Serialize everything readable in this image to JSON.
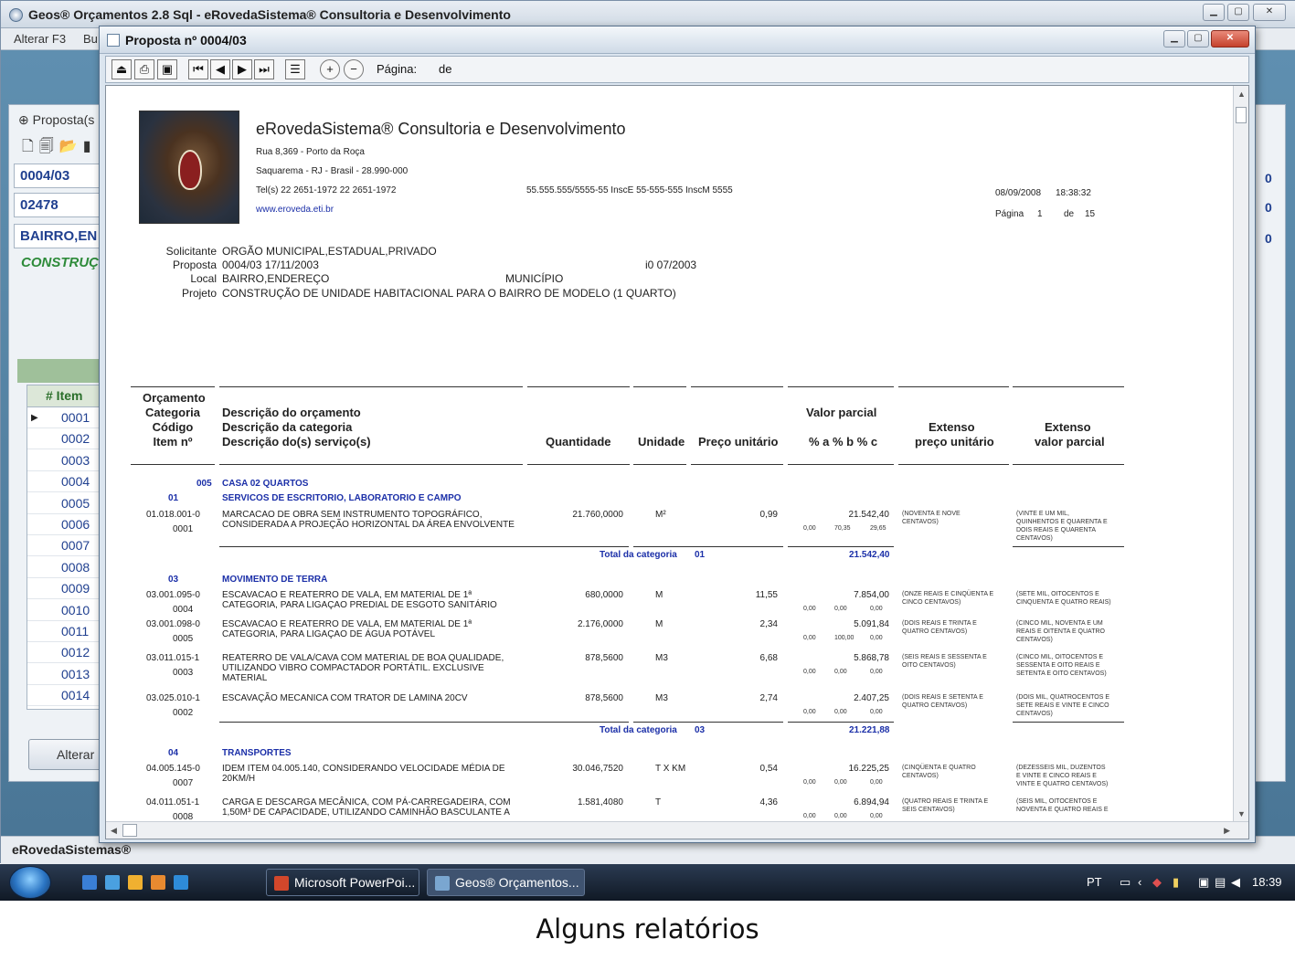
{
  "app": {
    "title": "Geos® Orçamentos 2.8 Sql - eRovedaSistema® Consultoria e Desenvolvimento",
    "menu": [
      "Alterar F3",
      "Bu"
    ],
    "status": "eRovedaSistemas®"
  },
  "left_panel": {
    "title": "Proposta(s",
    "fields": [
      "0004/03",
      "02478",
      "BAIRRO,EN"
    ],
    "construction": "CONSTRUÇ",
    "grid_header": "# Item",
    "rows": [
      "0001",
      "0002",
      "0003",
      "0004",
      "0005",
      "0006",
      "0007",
      "0008",
      "0009",
      "0010",
      "0011",
      "0012",
      "0013",
      "0014"
    ],
    "alterar": "Alterar"
  },
  "right_panel": {
    "values": [
      "0",
      "0",
      "0"
    ]
  },
  "dialog": {
    "title": "Proposta nº 0004/03",
    "page_label": "Página:",
    "of_label": "de"
  },
  "report": {
    "company": "eRovedaSistema® Consultoria e Desenvolvimento",
    "address": "Rua 8,369 - Porto da Roça",
    "city": "Saquarema - RJ - Brasil - 28.990-000",
    "phone": "Tel(s) 22 2651-1972 22 2651-1972",
    "docs": "55.555.555/5555-55 InscE 55-555-555 InscM 5555",
    "website": "www.eroveda.eti.br",
    "date": "08/09/2008",
    "time": "18:38:32",
    "page_label": "Página",
    "page_num": "1",
    "of_label": "de",
    "page_total": "15",
    "info": {
      "solicitante_label": "Solicitante",
      "solicitante": "ORGÃO MUNICIPAL,ESTADUAL,PRIVADO",
      "proposta_label": "Proposta",
      "proposta": "0004/03   17/11/2003",
      "proposta_extra": "i0   07/2003",
      "local_label": "Local",
      "local": "BAIRRO,ENDEREÇO",
      "municipio": "MUNICÍPIO",
      "projeto_label": "Projeto",
      "projeto": "CONSTRUÇÃO DE UNIDADE HABITACIONAL PARA O BAIRRO DE MODELO (1 QUARTO)"
    },
    "headers": {
      "col1": [
        "Orçamento",
        "Categoria",
        "Código",
        "Item nº"
      ],
      "col2": [
        "Descrição do orçamento",
        "Descrição da categoria",
        "Descrição do(s) serviço(s)"
      ],
      "quantidade": "Quantidade",
      "unidade": "Unidade",
      "preco": "Preço unitário",
      "valor_parcial": "Valor parcial",
      "percent": "% a % b % c",
      "extenso1": [
        "Extenso",
        "preço unitário"
      ],
      "extenso2": [
        "Extenso",
        "valor parcial"
      ]
    },
    "orcamento_code": "005",
    "orcamento_desc": "CASA 02 QUARTOS",
    "total_label": "Total da categoria",
    "categories": [
      {
        "code": "01",
        "name": "SERVICOS DE ESCRITORIO, LABORATORIO E CAMPO",
        "items": [
          {
            "code": "01.018.001-0",
            "num": "0001",
            "desc": [
              "MARCACAO  DE  OBRA  SEM  INSTRUMENTO  TOPOGRÁFICO,",
              "CONSIDERADA A PROJEÇÃO HORIZONTAL DA ÁREA ENVOLVENTE"
            ],
            "qty": "21.760,0000",
            "unit": "M²",
            "price": "0,99",
            "value": "21.542,40",
            "pct": [
              "0,00",
              "70,35",
              "29,65"
            ],
            "ext1": [
              "(NOVENTA E NOVE",
              "CENTAVOS)"
            ],
            "ext2": [
              "(VINTE E UM MIL,",
              "QUINHENTOS E QUARENTA E",
              "DOIS REAIS E QUARENTA",
              "CENTAVOS)"
            ]
          }
        ],
        "total_code": "01",
        "total": "21.542,40"
      },
      {
        "code": "03",
        "name": "MOVIMENTO DE TERRA",
        "items": [
          {
            "code": "03.001.095-0",
            "num": "0004",
            "desc": [
              "ESCAVACAO  E  REATERRO  DE  VALA,  EM  MATERIAL  DE  1ª",
              "CATEGORIA, PARA LIGAÇAO PREDIAL DE ESGOTO SANITÁRIO"
            ],
            "qty": "680,0000",
            "unit": "M",
            "price": "11,55",
            "value": "7.854,00",
            "pct": [
              "0,00",
              "0,00",
              "0,00"
            ],
            "ext1": [
              "(ONZE REAIS E CINQÜENTA E",
              "CINCO CENTAVOS)"
            ],
            "ext2": [
              "(SETE MIL, OITOCENTOS E",
              "CINQUENTA E QUATRO REAIS)"
            ]
          },
          {
            "code": "03.001.098-0",
            "num": "0005",
            "desc": [
              "ESCAVACAO  E  REATERRO  DE  VALA,  EM  MATERIAL  DE  1ª",
              "CATEGORIA, PARA LIGAÇAO DE ÁGUA POTÁVEL"
            ],
            "qty": "2.176,0000",
            "unit": "M",
            "price": "2,34",
            "value": "5.091,84",
            "pct": [
              "0,00",
              "100,00",
              "0,00"
            ],
            "ext1": [
              "(DOIS REAIS E TRINTA E",
              "QUATRO CENTAVOS)"
            ],
            "ext2": [
              "(CINCO MIL, NOVENTA E UM",
              "REAIS E OITENTA E QUATRO",
              "CENTAVOS)"
            ]
          },
          {
            "code": "03.011.015-1",
            "num": "0003",
            "desc": [
              "REATERRO DE VALA/CAVA COM MATERIAL DE BOA QUALIDADE,",
              "UTILIZANDO  VIBRO  COMPACTADOR  PORTÁTIL.  EXCLUSIVE",
              "MATERIAL"
            ],
            "qty": "878,5600",
            "unit": "M3",
            "price": "6,68",
            "value": "5.868,78",
            "pct": [
              "0,00",
              "0,00",
              "0,00"
            ],
            "ext1": [
              "(SEIS REAIS E SESSENTA E",
              "OITO CENTAVOS)"
            ],
            "ext2": [
              "(CINCO MIL, OITOCENTOS E",
              "SESSENTA E OITO REAIS E",
              "SETENTA E OITO CENTAVOS)"
            ]
          },
          {
            "code": "03.025.010-1",
            "num": "0002",
            "desc": [
              "ESCAVAÇÃO MECANICA COM TRATOR DE LAMINA 20CV"
            ],
            "qty": "878,5600",
            "unit": "M3",
            "price": "2,74",
            "value": "2.407,25",
            "pct": [
              "0,00",
              "0,00",
              "0,00"
            ],
            "ext1": [
              "(DOIS REAIS E SETENTA E",
              "QUATRO CENTAVOS)"
            ],
            "ext2": [
              "(DOIS MIL, QUATROCENTOS E",
              "SETE REAIS E VINTE E CINCO",
              "CENTAVOS)"
            ]
          }
        ],
        "total_code": "03",
        "total": "21.221,88"
      },
      {
        "code": "04",
        "name": "TRANSPORTES",
        "items": [
          {
            "code": "04.005.145-0",
            "num": "0007",
            "desc": [
              "IDEM ITEM 04.005.140, CONSIDERANDO VELOCIDADE MÉDIA DE",
              "20KM/H"
            ],
            "qty": "30.046,7520",
            "unit": "T X KM",
            "price": "0,54",
            "value": "16.225,25",
            "pct": [
              "0,00",
              "0,00",
              "0,00"
            ],
            "ext1": [
              "(CINQÜENTA E QUATRO",
              "CENTAVOS)"
            ],
            "ext2": [
              "(DEZESSEIS MIL, DUZENTOS",
              "E VINTE E CINCO REAIS E",
              "VINTE E QUATRO CENTAVOS)"
            ]
          },
          {
            "code": "04.011.051-1",
            "num": "0008",
            "desc": [
              "CARGA E DESCARGA MECÂNICA, COM PÁ-CARREGADEIRA, COM",
              "1,50M³ DE CAPACIDADE, UTILIZANDO CAMINHÃO BASCULANTE A"
            ],
            "qty": "1.581,4080",
            "unit": "T",
            "price": "4,36",
            "value": "6.894,94",
            "pct": [
              "0,00",
              "0,00",
              "0,00"
            ],
            "ext1": [
              "(QUATRO REAIS E TRINTA E",
              "SEIS CENTAVOS)"
            ],
            "ext2": [
              "(SEIS MIL, OITOCENTOS E",
              "NOVENTA E QUATRO REAIS E"
            ]
          }
        ]
      }
    ]
  },
  "taskbar": {
    "tasks": [
      "Microsoft PowerPoi...",
      "Geos® Orçamentos..."
    ],
    "lang": "PT",
    "clock": "18:39"
  },
  "caption": "Alguns relatórios"
}
